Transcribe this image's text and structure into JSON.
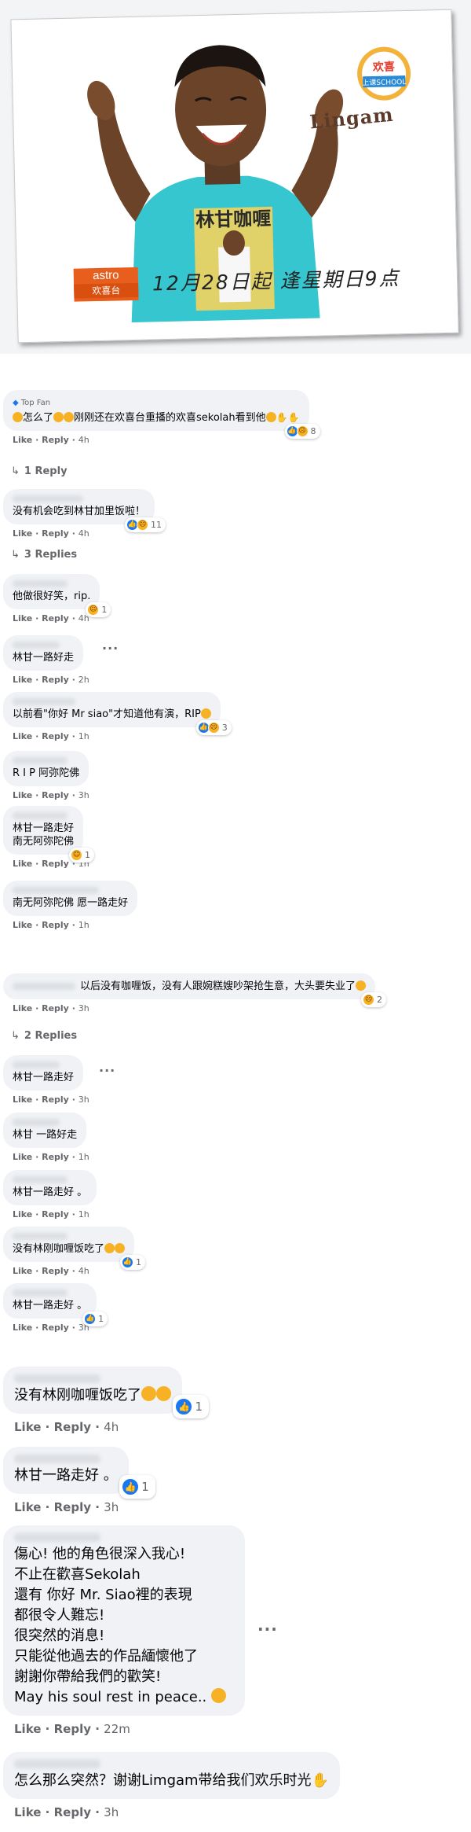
{
  "poster": {
    "show_logo_top": "欢喜",
    "show_logo_bottom": "上课SCHOOL",
    "shirt_text": "林甘咖喱",
    "name": "Lingam",
    "channel_line1": "astro",
    "channel_line2": "欢喜台",
    "schedule": "12月28日起  逢星期日9点"
  },
  "labels": {
    "like": "Like",
    "reply": "Reply",
    "dot": " · ",
    "top_fan": "Top Fan"
  },
  "comments": [
    {
      "text": "怎么了",
      "text2": "刚刚还在欢喜台重播的欢喜sekolah看到他",
      "time": "4h",
      "reaction_count": "8",
      "replies": "1 Reply"
    },
    {
      "text": "没有机会吃到林甘加里饭啦！",
      "time": "4h",
      "reaction_count": "11",
      "replies": "3 Replies"
    },
    {
      "text": "他做很好笑，rip.",
      "time": "4h",
      "reaction_count": "1"
    },
    {
      "text": "林甘一路好走",
      "time": "2h"
    },
    {
      "text": "以前看\"你好 Mr siao\"才知道他有演，RIP",
      "time": "1h",
      "reaction_count": "3"
    },
    {
      "text": "R I P 阿弥陀佛",
      "time": "3h"
    },
    {
      "text": "林甘一路走好\n南无阿弥陀佛",
      "time": "1h",
      "reaction_count": "1"
    },
    {
      "text": "南无阿弥陀佛 愿一路走好",
      "time": "1h"
    },
    {
      "text": "以后没有咖喱饭，没有人跟婉糕嫂吵架抢生意，大头要失业了",
      "time": "3h",
      "reaction_count": "2",
      "replies": "2 Replies"
    },
    {
      "text": "林甘一路走好",
      "time": "3h"
    },
    {
      "text": "林甘 一路好走",
      "time": "1h"
    },
    {
      "text": "林甘一路走好 。",
      "time": "1h"
    },
    {
      "text": "没有林刚咖喱饭吃了",
      "time": "4h",
      "reaction_count": "1"
    },
    {
      "text": "林甘一路走好 。",
      "time": "3h",
      "reaction_count": "1"
    },
    {
      "text": "没有林刚咖喱饭吃了",
      "time": "4h",
      "reaction_count": "1"
    },
    {
      "text": "林甘一路走好 。",
      "time": "3h",
      "reaction_count": "1"
    },
    {
      "text": "傷心! 他的角色很深入我心!\n不止在歡喜Sekolah\n還有 你好 Mr. Siao裡的表現\n都很令人難忘!\n很突然的消息!\n只能從他過去的作品緬懷他了\n謝謝你帶給我們的歡笑!\nMay his soul rest in peace..",
      "time": "22m"
    },
    {
      "text": "怎么那么突然？谢谢Limgam带给我们欢乐时光",
      "time": "3h"
    }
  ],
  "icons": {
    "more": "more-options-icon",
    "reply_arrow": "reply-arrow-icon"
  },
  "colors": {
    "bubble": "#f0f2f5",
    "meta": "#65676b",
    "like_blue": "#1877f2",
    "emoji_yellow": "#f7b125"
  }
}
